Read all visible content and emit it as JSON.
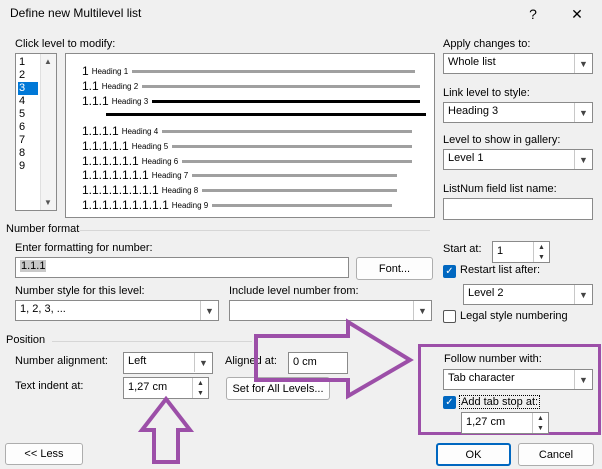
{
  "dialog": {
    "title": "Define new Multilevel list",
    "help": "?",
    "close": "✕"
  },
  "levels": {
    "label": "Click level to modify:",
    "items": [
      "1",
      "2",
      "3",
      "4",
      "5",
      "6",
      "7",
      "8",
      "9"
    ],
    "selected": "3"
  },
  "preview": {
    "rows": [
      {
        "num": "1",
        "heading": "Heading 1"
      },
      {
        "num": "1.1",
        "heading": "Heading 2"
      },
      {
        "num": "1.1.1",
        "heading": "Heading 3"
      },
      {
        "num": "1.1.1.1",
        "heading": "Heading 4"
      },
      {
        "num": "1.1.1.1.1",
        "heading": "Heading 5"
      },
      {
        "num": "1.1.1.1.1.1",
        "heading": "Heading 6"
      },
      {
        "num": "1.1.1.1.1.1.1",
        "heading": "Heading 7"
      },
      {
        "num": "1.1.1.1.1.1.1.1",
        "heading": "Heading 8"
      },
      {
        "num": "1.1.1.1.1.1.1.1.1",
        "heading": "Heading 9"
      }
    ]
  },
  "right": {
    "apply_label": "Apply changes to:",
    "apply_value": "Whole list",
    "link_label": "Link level to style:",
    "link_value": "Heading 3",
    "gallery_label": "Level to show in gallery:",
    "gallery_value": "Level 1",
    "listnum_label": "ListNum field list name:",
    "listnum_value": ""
  },
  "number_format": {
    "section": "Number format",
    "enter_label": "Enter formatting for number:",
    "enter_value": "1.1.1",
    "font_button": "Font...",
    "style_label": "Number style for this level:",
    "style_value": "1, 2, 3, ...",
    "include_label": "Include level number from:",
    "include_value": "",
    "start_label": "Start at:",
    "start_value": "1",
    "restart_label": "Restart list after:",
    "restart_value": "Level 2",
    "legal_label": "Legal style numbering"
  },
  "position": {
    "section": "Position",
    "align_label": "Number alignment:",
    "align_value": "Left",
    "aligned_at_label": "Aligned at:",
    "aligned_at_value": "0 cm",
    "indent_label": "Text indent at:",
    "indent_value": "1,27 cm",
    "set_all_button": "Set for All Levels...",
    "follow_label": "Follow number with:",
    "follow_value": "Tab character",
    "tab_stop_label": "Add tab stop at:",
    "tab_stop_value": "1,27 cm"
  },
  "buttons": {
    "less": "<< Less",
    "ok": "OK",
    "cancel": "Cancel"
  },
  "annotation_color": "#9c4fa8"
}
